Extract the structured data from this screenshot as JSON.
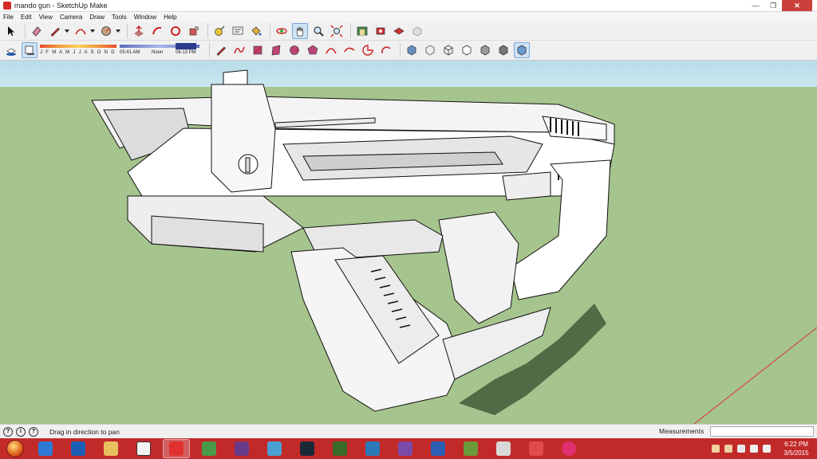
{
  "window": {
    "title": "mando gun - SketchUp Make"
  },
  "menu": [
    "File",
    "Edit",
    "View",
    "Camera",
    "Draw",
    "Tools",
    "Window",
    "Help"
  ],
  "shadow": {
    "months": "J F M A M J J A S O N D",
    "time_start": "05:41 AM",
    "time_mid": "Noon",
    "time_end": "06:13 PM"
  },
  "status": {
    "hint": "Drag in direction to pan",
    "measurements_label": "Measurements",
    "measurements_value": ""
  },
  "clock": {
    "time": "6:22 PM",
    "date": "3/5/2015"
  },
  "colors": {
    "viewport_ground": "#a6c48d",
    "viewport_sky": "#c0e2ec",
    "taskbar": "#c22a2a"
  }
}
